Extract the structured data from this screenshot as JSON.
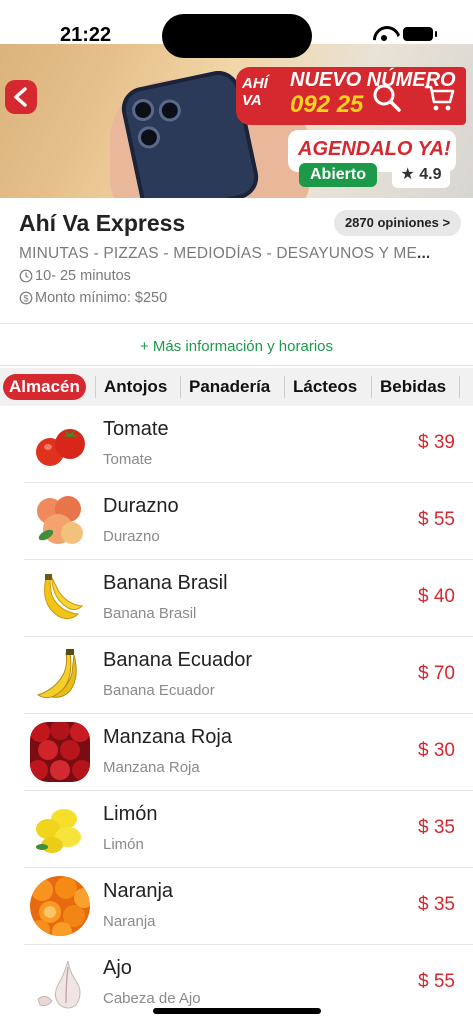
{
  "status": {
    "time": "21:22"
  },
  "banner": {
    "logo_text": "AHÍ VA",
    "promo_line1": "NUEVO NÚMERO",
    "promo_line2": "092 25",
    "promo_cta": "AGENDALO YA!",
    "status_label": "Abierto",
    "rating": "4.9",
    "icons": [
      "back-icon",
      "search-icon",
      "cart-icon",
      "star-icon"
    ]
  },
  "store": {
    "name": "Ahí Va Express",
    "reviews_label": "2870 opiniones >",
    "categories": "MINUTAS - PIZZAS - MEDIODÍAS - DESAYUNOS Y ME",
    "categories_ellipsis": "...",
    "delivery_time": "10- 25 minutos",
    "min_amount": "Monto mínimo: $250",
    "more_info": "+ Más información y horarios"
  },
  "tabs": [
    "Almacén",
    "Antojos",
    "Panadería",
    "Lácteos",
    "Bebidas"
  ],
  "products": [
    {
      "name": "Tomate",
      "desc": "Tomate",
      "price": "$ 39",
      "icon": "tomato-icon"
    },
    {
      "name": "Durazno",
      "desc": "Durazno",
      "price": "$ 55",
      "icon": "peach-icon"
    },
    {
      "name": "Banana Brasil",
      "desc": "Banana Brasil",
      "price": "$ 40",
      "icon": "banana-icon"
    },
    {
      "name": "Banana Ecuador",
      "desc": "Banana Ecuador",
      "price": "$ 70",
      "icon": "banana-icon"
    },
    {
      "name": "Manzana Roja",
      "desc": "Manzana Roja",
      "price": "$ 30",
      "icon": "apple-icon"
    },
    {
      "name": "Limón",
      "desc": "Limón",
      "price": "$ 35",
      "icon": "lemon-icon"
    },
    {
      "name": "Naranja",
      "desc": "Naranja",
      "price": "$ 35",
      "icon": "orange-icon"
    },
    {
      "name": "Ajo",
      "desc": "Cabeza de Ajo",
      "price": "$ 55",
      "icon": "garlic-icon"
    }
  ],
  "colors": {
    "accent": "#d6282f",
    "open": "#1c9a4a",
    "muted": "#7a7a7a"
  }
}
